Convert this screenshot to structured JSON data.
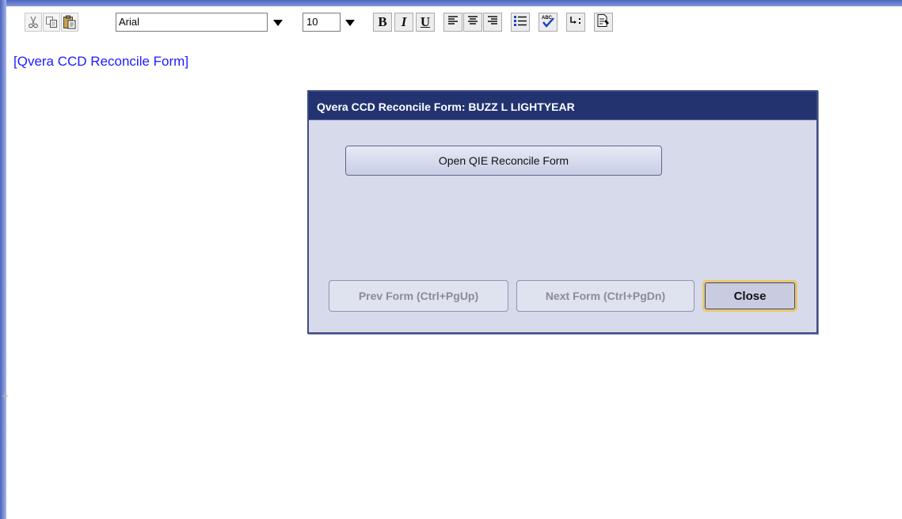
{
  "toolbar": {
    "font_name": "Arial",
    "font_size": "10",
    "bold_label": "B",
    "italic_label": "I",
    "underline_label": "U",
    "icons": [
      "cut-icon",
      "copy-icon",
      "paste-icon",
      "font-dropdown-icon",
      "size-dropdown-icon",
      "align-left-icon",
      "align-center-icon",
      "align-right-icon",
      "bullet-list-icon",
      "spellcheck-icon",
      "insert-field-icon",
      "form-icon"
    ]
  },
  "document": {
    "title": "[Qvera CCD Reconcile Form]"
  },
  "dialog": {
    "title": "Qvera CCD Reconcile Form:  BUZZ L LIGHTYEAR",
    "open_button": "Open QIE Reconcile Form",
    "prev_button": "Prev Form (Ctrl+PgUp)",
    "next_button": "Next Form (Ctrl+PgDn)",
    "close_button": "Close"
  },
  "colors": {
    "dialog_titlebar": "#223370",
    "dialog_body": "#d7daea",
    "doc_title_text": "#1b1bff",
    "close_highlight": "#e9c86b"
  }
}
